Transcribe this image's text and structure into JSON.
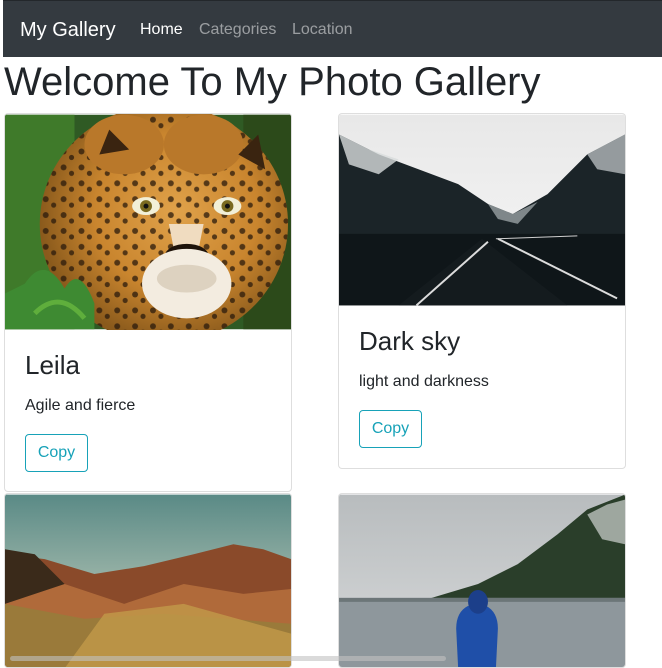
{
  "navbar": {
    "brand": "My Gallery",
    "links": [
      {
        "label": "Home",
        "active": true
      },
      {
        "label": "Categories",
        "active": false
      },
      {
        "label": "Location",
        "active": false
      }
    ]
  },
  "page": {
    "title": "Welcome To My Photo Gallery"
  },
  "cards": [
    {
      "image": "jaguar photo",
      "title": "Leila",
      "text": "Agile and fierce",
      "button": "Copy"
    },
    {
      "image": "dark mountain road photo",
      "title": "Dark sky",
      "text": "light and darkness",
      "button": "Copy"
    },
    {
      "image": "desert mountains photo"
    },
    {
      "image": "person by lake photo"
    }
  ],
  "colors": {
    "navbar_bg": "#343a40",
    "button_accent": "#17a2b8"
  }
}
